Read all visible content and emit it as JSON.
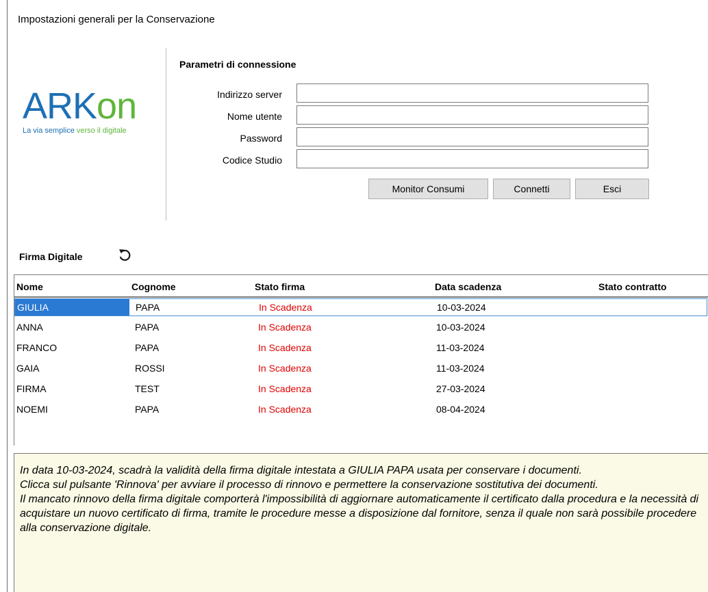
{
  "window": {
    "title": "Impostazioni generali per la Conservazione"
  },
  "logo": {
    "ark": "ARK",
    "on": "on",
    "tagline_blue": "La via semplice",
    "tagline_green": "verso il digitale"
  },
  "connection": {
    "title": "Parametri di connessione",
    "fields": [
      {
        "label": "Indirizzo server",
        "value": ""
      },
      {
        "label": "Nome utente",
        "value": ""
      },
      {
        "label": "Password",
        "value": ""
      },
      {
        "label": "Codice Studio",
        "value": ""
      }
    ],
    "buttons": {
      "monitor": "Monitor Consumi",
      "connect": "Connetti",
      "exit": "Esci"
    }
  },
  "firma": {
    "title": "Firma Digitale",
    "refresh_icon": "refresh-icon",
    "columns": [
      "Nome",
      "Cognome",
      "Stato firma",
      "Data scadenza",
      "Stato contratto"
    ],
    "rows": [
      {
        "nome": "GIULIA",
        "cognome": "PAPA",
        "stato": "In Scadenza",
        "data": "10-03-2024",
        "contratto": ""
      },
      {
        "nome": "ANNA",
        "cognome": "PAPA",
        "stato": "In Scadenza",
        "data": "10-03-2024",
        "contratto": ""
      },
      {
        "nome": "FRANCO",
        "cognome": "PAPA",
        "stato": "In Scadenza",
        "data": "11-03-2024",
        "contratto": ""
      },
      {
        "nome": "GAIA",
        "cognome": "ROSSI",
        "stato": "In Scadenza",
        "data": "11-03-2024",
        "contratto": ""
      },
      {
        "nome": "FIRMA",
        "cognome": "TEST",
        "stato": "In Scadenza",
        "data": "27-03-2024",
        "contratto": ""
      },
      {
        "nome": "NOEMI",
        "cognome": "PAPA",
        "stato": "In Scadenza",
        "data": "08-04-2024",
        "contratto": ""
      }
    ]
  },
  "message": {
    "p1": "In data 10-03-2024, scadrà la validità della firma digitale intestata a GIULIA PAPA usata per conservare i documenti.",
    "p2": "Clicca sul pulsante 'Rinnova' per avviare il processo di rinnovo e permettere la conservazione sostitutiva dei documenti.",
    "p3": "Il mancato rinnovo della firma digitale comporterà l'impossibilità di aggiornare automaticamente il certificato dalla procedura e la necessità di acquistare un nuovo certificato di firma, tramite le procedure messe a disposizione dal fornitore, senza il quale non sarà possibile procedere alla conservazione digitale."
  },
  "colors": {
    "accent_blue": "#1e6fb5",
    "accent_green": "#5fb53a",
    "status_red": "#e00000",
    "selection": "#2a7ad4"
  }
}
